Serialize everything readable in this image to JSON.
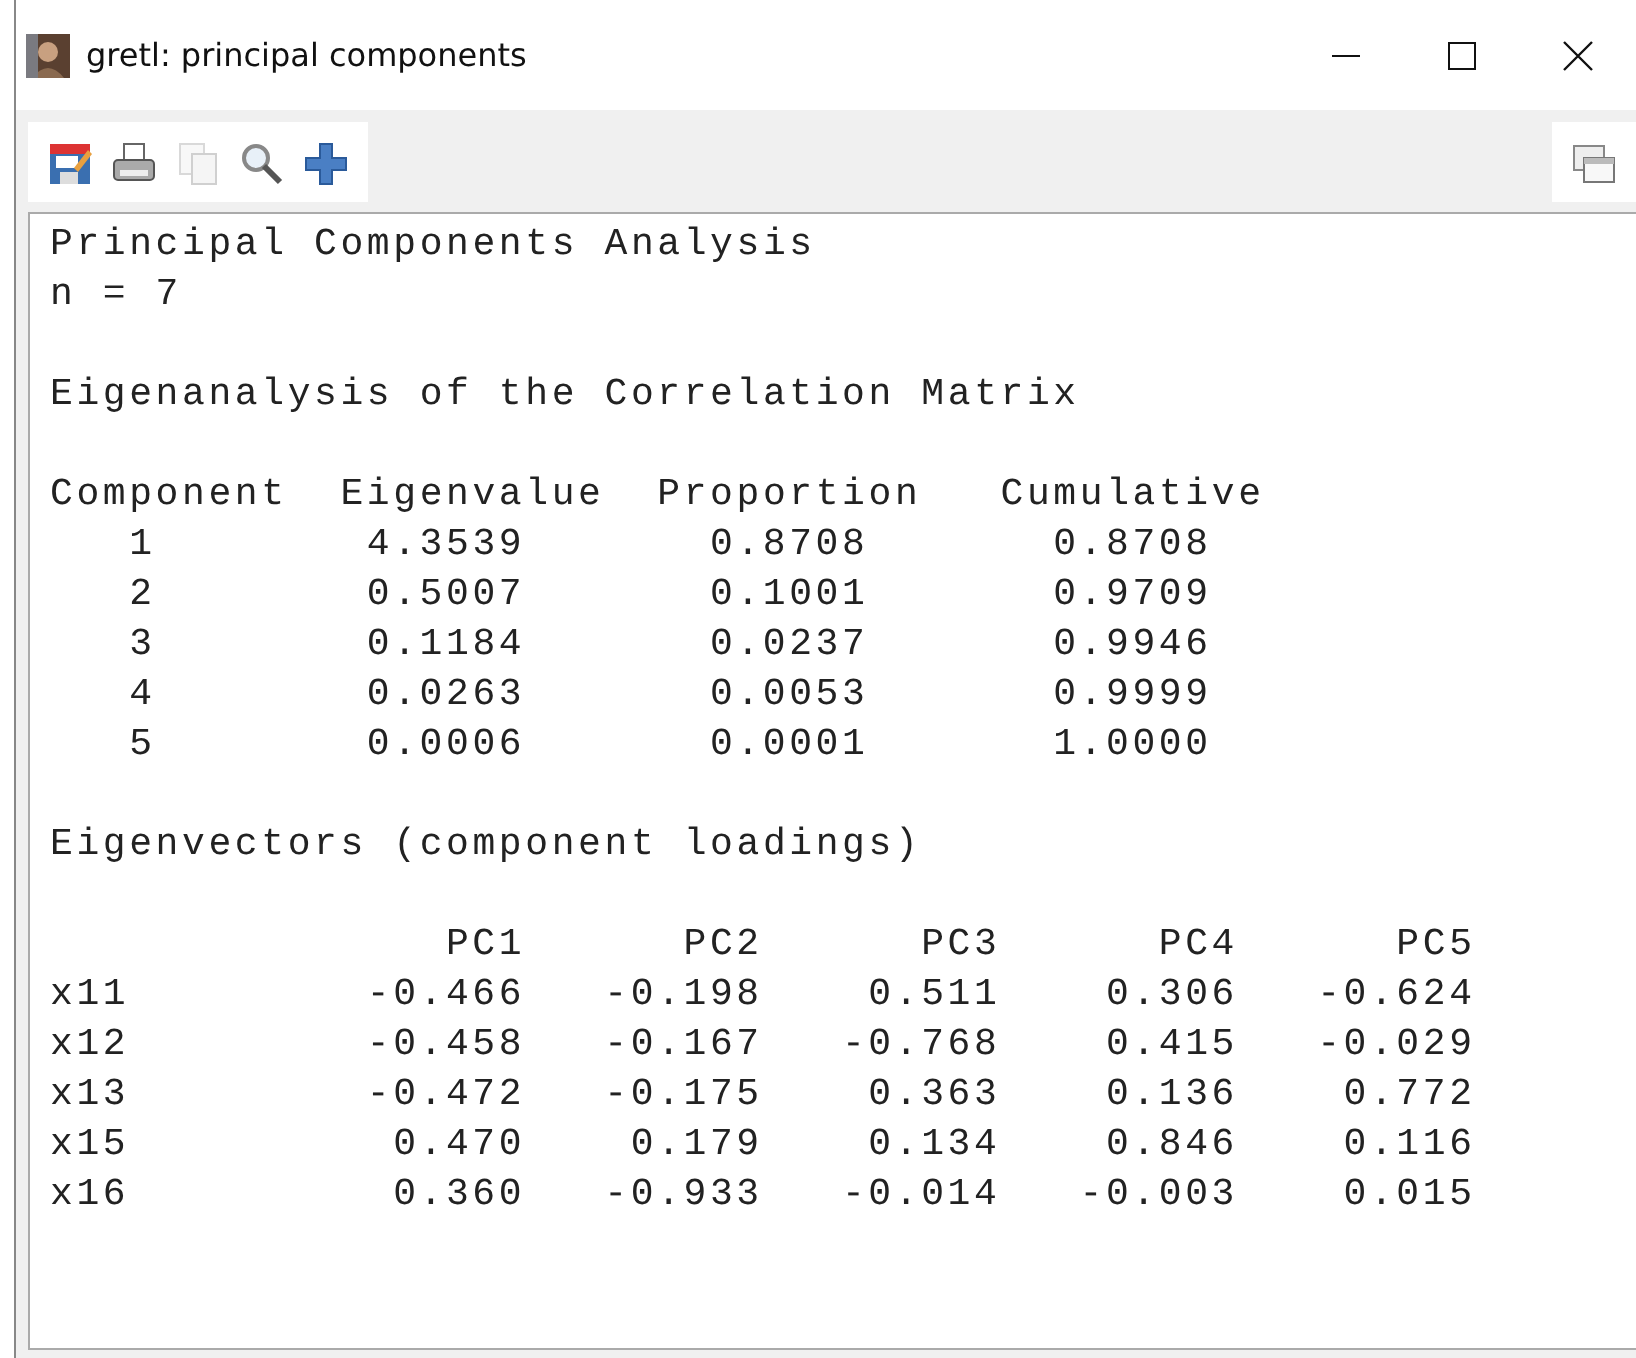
{
  "window": {
    "title": "gretl: principal components"
  },
  "toolbar": [
    {
      "kind": "save",
      "disabled": false
    },
    {
      "kind": "print",
      "disabled": false
    },
    {
      "kind": "copy",
      "disabled": true
    },
    {
      "kind": "find",
      "disabled": false
    },
    {
      "kind": "add",
      "disabled": false
    }
  ],
  "toolbar_right": [
    {
      "kind": "windows",
      "disabled": false
    }
  ],
  "output": {
    "title": "Principal Components Analysis",
    "n_line": "n = 7",
    "eigen_heading": "Eigenanalysis of the Correlation Matrix",
    "eigen_columns": [
      "Component",
      "Eigenvalue",
      "Proportion",
      "Cumulative"
    ],
    "eigen_rows": [
      [
        "1",
        "4.3539",
        "0.8708",
        "0.8708"
      ],
      [
        "2",
        "0.5007",
        "0.1001",
        "0.9709"
      ],
      [
        "3",
        "0.1184",
        "0.0237",
        "0.9946"
      ],
      [
        "4",
        "0.0263",
        "0.0053",
        "0.9999"
      ],
      [
        "5",
        "0.0006",
        "0.0001",
        "1.0000"
      ]
    ],
    "loadings_heading": "Eigenvectors (component loadings)",
    "loadings_columns": [
      "PC1",
      "PC2",
      "PC3",
      "PC4",
      "PC5"
    ],
    "loadings_rows": [
      {
        "variable": "x11",
        "values": [
          "-0.466",
          "-0.198",
          "0.511",
          "0.306",
          "-0.624"
        ]
      },
      {
        "variable": "x12",
        "values": [
          "-0.458",
          "-0.167",
          "-0.768",
          "0.415",
          "-0.029"
        ]
      },
      {
        "variable": "x13",
        "values": [
          "-0.472",
          "-0.175",
          "0.363",
          "0.136",
          "0.772"
        ]
      },
      {
        "variable": "x15",
        "values": [
          "0.470",
          "0.179",
          "0.134",
          "0.846",
          "0.116"
        ]
      },
      {
        "variable": "x16",
        "values": [
          "0.360",
          "-0.933",
          "-0.014",
          "-0.003",
          "0.015"
        ]
      }
    ]
  }
}
